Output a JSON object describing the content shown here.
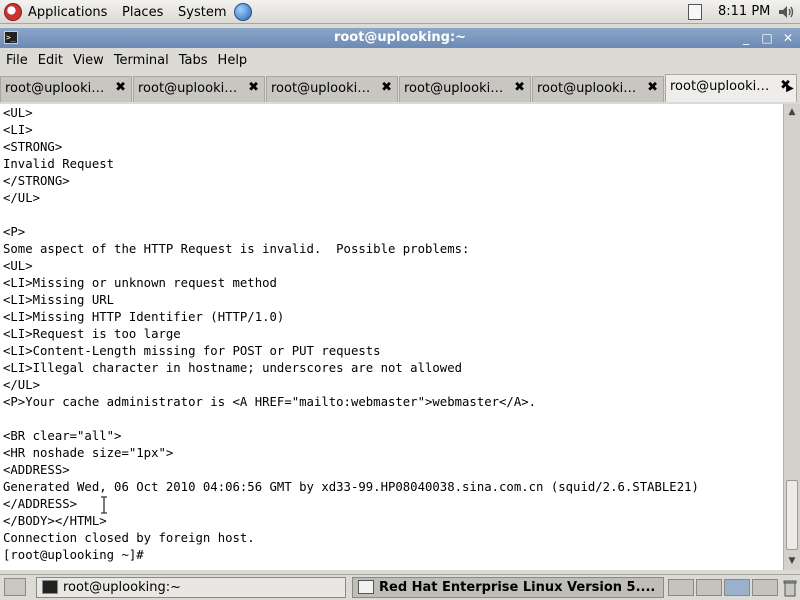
{
  "top_panel": {
    "menus": [
      "Applications",
      "Places",
      "System"
    ],
    "clock": "8:11 PM"
  },
  "window": {
    "title": "root@uplooking:~",
    "menu": [
      "File",
      "Edit",
      "View",
      "Terminal",
      "Tabs",
      "Help"
    ]
  },
  "tabs": [
    {
      "label": "root@uplooki…",
      "close": "✖"
    },
    {
      "label": "root@uplooki…",
      "close": "✖"
    },
    {
      "label": "root@uplooki…",
      "close": "✖"
    },
    {
      "label": "root@uplooki…",
      "close": "✖"
    },
    {
      "label": "root@uplooki…",
      "close": "✖"
    },
    {
      "label": "root@uplooki…",
      "close": "✖"
    }
  ],
  "terminal": {
    "lines": [
      "<UL>",
      "<LI>",
      "<STRONG>",
      "Invalid Request",
      "</STRONG>",
      "</UL>",
      "",
      "<P>",
      "Some aspect of the HTTP Request is invalid.  Possible problems:",
      "<UL>",
      "<LI>Missing or unknown request method",
      "<LI>Missing URL",
      "<LI>Missing HTTP Identifier (HTTP/1.0)",
      "<LI>Request is too large",
      "<LI>Content-Length missing for POST or PUT requests",
      "<LI>Illegal character in hostname; underscores are not allowed",
      "</UL>",
      "<P>Your cache administrator is <A HREF=\"mailto:webmaster\">webmaster</A>.",
      "",
      "<BR clear=\"all\">",
      "<HR noshade size=\"1px\">",
      "<ADDRESS>",
      "Generated Wed, 06 Oct 2010 04:06:56 GMT by xd33-99.HP08040038.sina.com.cn (squid/2.6.STABLE21)",
      "</ADDRESS>",
      "</BODY></HTML>",
      "Connection closed by foreign host.",
      "[root@uplooking ~]#"
    ]
  },
  "taskbar": {
    "tasks": [
      {
        "label": "root@uplooking:~",
        "icon": "terminal-icon"
      },
      {
        "label": "Red Hat Enterprise Linux Version 5....",
        "icon": "window-icon"
      }
    ]
  },
  "icons": {
    "apps": "redhat-icon",
    "web": "globe-icon",
    "network": "network-icon",
    "volume": "volume-icon"
  }
}
